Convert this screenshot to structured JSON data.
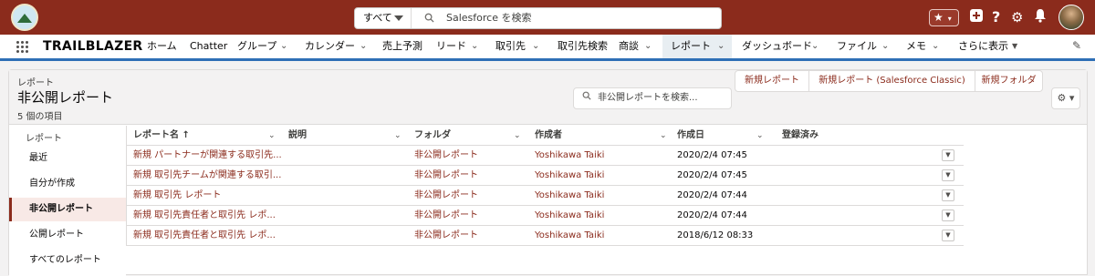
{
  "global": {
    "search_scope": "すべて",
    "search_text": "Salesforce を検索",
    "star_icon": "★",
    "add_icon": "+",
    "help_icon": "?",
    "setup_icon": "⚙",
    "bell_icon": "🔔"
  },
  "nav": {
    "app_name": "TRAILBLAZER",
    "items": [
      {
        "label": "ホーム"
      },
      {
        "label": "Chatter"
      },
      {
        "label": "グループ"
      },
      {
        "label": "カレンダー"
      },
      {
        "label": "売上予測"
      },
      {
        "label": "リード"
      },
      {
        "label": "取引先"
      },
      {
        "label": "取引先検索"
      },
      {
        "label": "商談"
      },
      {
        "label": "レポート"
      },
      {
        "label": "ダッシュボード"
      },
      {
        "label": "ファイル"
      },
      {
        "label": "メモ"
      },
      {
        "label": "さらに表示"
      }
    ],
    "chevron": "⌄",
    "more_caret": "▼",
    "edit_icon": "✎"
  },
  "header": {
    "breadcrumb": "レポート",
    "title": "非公開レポート",
    "count": "5 個の項目",
    "search_placeholder": "非公開レポートを検索...",
    "search_icon": "🔍",
    "buttons": {
      "new_report": "新規レポート",
      "new_report_classic": "新規レポート (Salesforce Classic)",
      "new_folder": "新規フォルダ"
    },
    "settings_icon": "⚙ ▾"
  },
  "sidebar": {
    "heading": "レポート",
    "items": [
      {
        "label": "最近"
      },
      {
        "label": "自分が作成"
      },
      {
        "label": "非公開レポート"
      },
      {
        "label": "公開レポート"
      },
      {
        "label": "すべてのレポート"
      }
    ]
  },
  "table": {
    "columns": {
      "name": "レポート名 ↑",
      "description": "説明",
      "folder": "フォルダ",
      "author": "作成者",
      "created": "作成日",
      "subscribed": "登録済み"
    },
    "col_chevron": "⌄",
    "row_menu_icon": "▼",
    "rows": [
      {
        "name": "新規 パートナーが関連する取引先...",
        "folder": "非公開レポート",
        "author": "Yoshikawa Taiki",
        "created": "2020/2/4 07:45"
      },
      {
        "name": "新規 取引先チームが関連する取引...",
        "folder": "非公開レポート",
        "author": "Yoshikawa Taiki",
        "created": "2020/2/4 07:45"
      },
      {
        "name": "新規 取引先 レポート",
        "folder": "非公開レポート",
        "author": "Yoshikawa Taiki",
        "created": "2020/2/4 07:44"
      },
      {
        "name": "新規 取引先責任者と取引先 レポ...",
        "folder": "非公開レポート",
        "author": "Yoshikawa Taiki",
        "created": "2020/2/4 07:44"
      },
      {
        "name": "新規 取引先責任者と取引先 レポ...",
        "folder": "非公開レポート",
        "author": "Yoshikawa Taiki",
        "created": "2018/6/12 08:33"
      }
    ]
  },
  "colors": {
    "brand": "#8b2b1c",
    "nav_underline": "#2e6fb6"
  }
}
